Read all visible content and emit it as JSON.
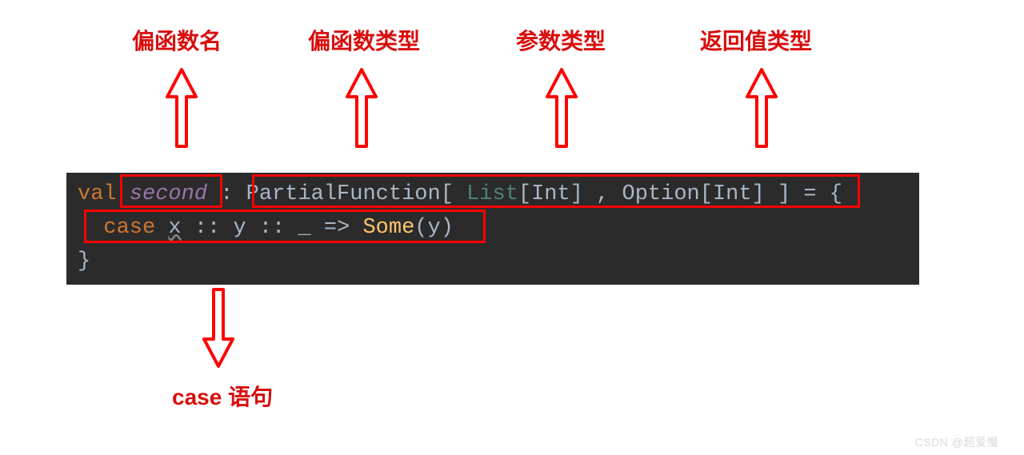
{
  "labels": {
    "fnName": "偏函数名",
    "fnType": "偏函数类型",
    "argType": "参数类型",
    "retType": "返回值类型",
    "caseStmt": "case 语句"
  },
  "code": {
    "val": "val",
    "name": "second",
    "colon": ":",
    "partialFn": "PartialFunction",
    "lbr": "[",
    "listTy": "List",
    "lbr2": "[",
    "intTy": "Int",
    "rbr2": "]",
    "comma": ",",
    "optionTy": "Option",
    "lbr3": "[",
    "intTy2": "Int",
    "rbr3": "]",
    "rbr": "]",
    "eq": "=",
    "lbrace": "{",
    "caseKw": "case",
    "x": "x",
    "cons1": "::",
    "y": "y",
    "cons2": "::",
    "under": "_",
    "arrow": "=>",
    "some": "Some",
    "lp": "(",
    "yArg": "y",
    "rp": ")",
    "rbrace": "}"
  },
  "colors": {
    "annotation": "#d90d0d",
    "keyword": "#cc7832",
    "identifier": "#9876aa",
    "type": "#4e807d",
    "call": "#ffc66d",
    "text": "#a9b7c6",
    "boxBorder": "#ff0000",
    "codeBg": "#2b2b2b"
  },
  "watermark": "CSDN @超爱慢"
}
